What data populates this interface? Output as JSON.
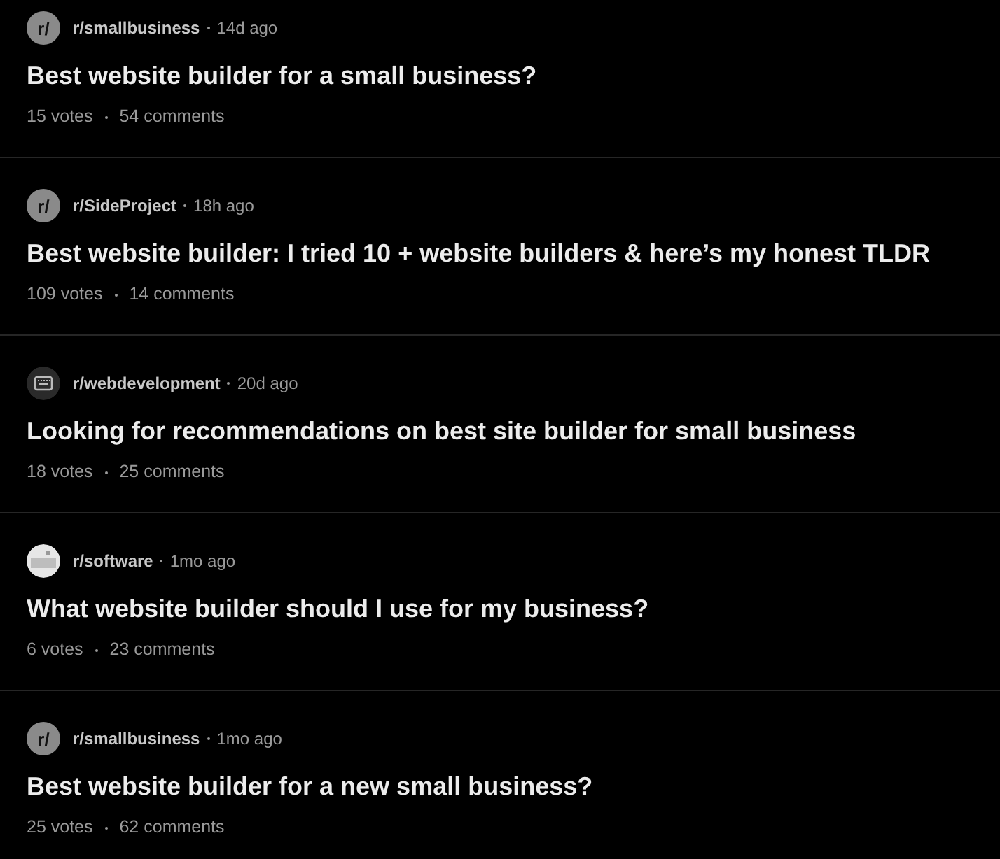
{
  "posts": [
    {
      "avatar": {
        "kind": "text",
        "text": "r/"
      },
      "subreddit": "r/smallbusiness",
      "time": "14d ago",
      "title": "Best website builder for a small business?",
      "votes": "15 votes",
      "comments": "54 comments"
    },
    {
      "avatar": {
        "kind": "text",
        "text": "r/"
      },
      "subreddit": "r/SideProject",
      "time": "18h ago",
      "title": "Best website builder: I tried 10 + website builders & here’s my honest TLDR",
      "votes": "109 votes",
      "comments": "14 comments"
    },
    {
      "avatar": {
        "kind": "keyboard"
      },
      "subreddit": "r/webdevelopment",
      "time": "20d ago",
      "title": "Looking for recommendations on best site builder for small business",
      "votes": "18 votes",
      "comments": "25 comments"
    },
    {
      "avatar": {
        "kind": "window"
      },
      "subreddit": "r/software",
      "time": "1mo ago",
      "title": "What website builder should I use for my business?",
      "votes": "6 votes",
      "comments": "23 comments"
    },
    {
      "avatar": {
        "kind": "text",
        "text": "r/"
      },
      "subreddit": "r/smallbusiness",
      "time": "1mo ago",
      "title": "Best website builder for a new small business?",
      "votes": "25 votes",
      "comments": "62 comments"
    }
  ]
}
